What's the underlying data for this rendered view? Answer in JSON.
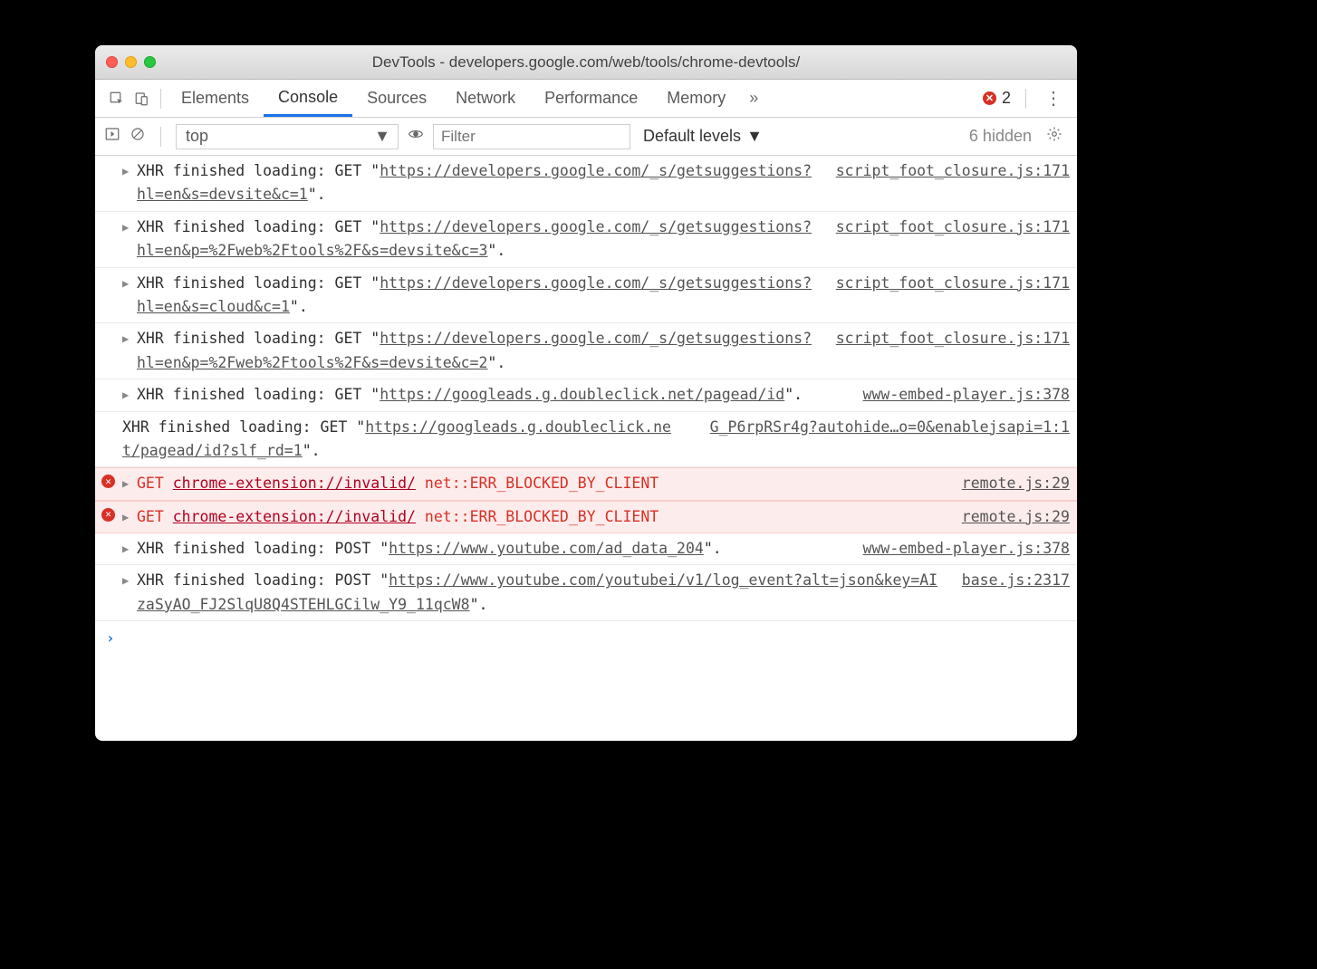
{
  "window": {
    "title": "DevTools - developers.google.com/web/tools/chrome-devtools/"
  },
  "tabs": {
    "items": [
      "Elements",
      "Console",
      "Sources",
      "Network",
      "Performance",
      "Memory"
    ],
    "active": "Console",
    "errorCount": "2"
  },
  "toolbar": {
    "context": "top",
    "filterPlaceholder": "Filter",
    "levels": "Default levels",
    "hidden": "6 hidden"
  },
  "messages": [
    {
      "type": "xhr",
      "disclosure": true,
      "prefix": "XHR finished loading: GET \"",
      "url": "https://developers.google.com/_s/getsuggestions?hl=en&s=devsite&c=1",
      "suffix": "\".",
      "source": "script_foot_closure.js:171"
    },
    {
      "type": "xhr",
      "disclosure": true,
      "prefix": "XHR finished loading: GET \"",
      "url": "https://developers.google.com/_s/getsuggestions?hl=en&p=%2Fweb%2Ftools%2F&s=devsite&c=3",
      "suffix": "\".",
      "source": "script_foot_closure.js:171"
    },
    {
      "type": "xhr",
      "disclosure": true,
      "prefix": "XHR finished loading: GET \"",
      "url": "https://developers.google.com/_s/getsuggestions?hl=en&s=cloud&c=1",
      "suffix": "\".",
      "source": "script_foot_closure.js:171"
    },
    {
      "type": "xhr",
      "disclosure": true,
      "prefix": "XHR finished loading: GET \"",
      "url": "https://developers.google.com/_s/getsuggestions?hl=en&p=%2Fweb%2Ftools%2F&s=devsite&c=2",
      "suffix": "\".",
      "source": "script_foot_closure.js:171"
    },
    {
      "type": "xhr",
      "disclosure": true,
      "prefix": "XHR finished loading: GET \"",
      "url": "https://googleads.g.doubleclick.net/pagead/id",
      "suffix": "\".",
      "source": "www-embed-player.js:378"
    },
    {
      "type": "xhr",
      "disclosure": false,
      "prefix": "XHR finished loading: GET \"",
      "url": "https://googleads.g.doubleclick.net/pagead/id?slf_rd=1",
      "suffix": "\".",
      "source": "G_P6rpRSr4g?autohide…o=0&enablejsapi=1:1"
    },
    {
      "type": "error",
      "disclosure": true,
      "method": "GET",
      "url": "chrome-extension://invalid/",
      "errtext": "net::ERR_BLOCKED_BY_CLIENT",
      "source": "remote.js:29"
    },
    {
      "type": "error",
      "disclosure": true,
      "method": "GET",
      "url": "chrome-extension://invalid/",
      "errtext": "net::ERR_BLOCKED_BY_CLIENT",
      "source": "remote.js:29"
    },
    {
      "type": "xhr",
      "disclosure": true,
      "prefix": "XHR finished loading: POST \"",
      "url": "https://www.youtube.com/ad_data_204",
      "suffix": "\".",
      "source": "www-embed-player.js:378"
    },
    {
      "type": "xhr",
      "disclosure": true,
      "prefix": "XHR finished loading: POST \"",
      "url": "https://www.youtube.com/youtubei/v1/log_event?alt=json&key=AIzaSyAO_FJ2SlqU8Q4STEHLGCilw_Y9_11qcW8",
      "suffix": "\".",
      "source": "base.js:2317"
    }
  ]
}
